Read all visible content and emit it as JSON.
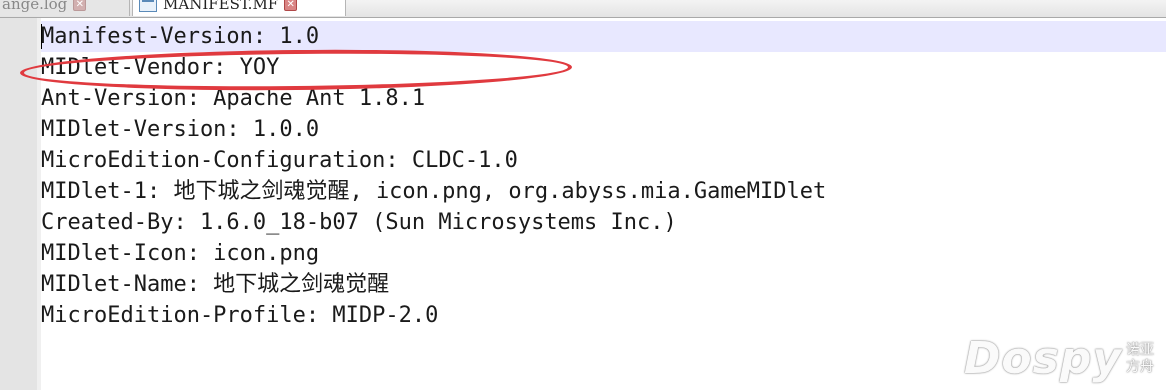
{
  "tabs": [
    {
      "label": "ange.log",
      "active": false
    },
    {
      "label": "MANIFEST.MF",
      "active": true
    }
  ],
  "editor": {
    "lines": [
      "Manifest-Version: 1.0",
      "MIDlet-Vendor: YOY",
      "Ant-Version: Apache Ant 1.8.1",
      "MIDlet-Version: 1.0.0",
      "MicroEdition-Configuration: CLDC-1.0",
      "MIDlet-1: 地下城之剑魂觉醒, icon.png, org.abyss.mia.GameMIDlet",
      "Created-By: 1.6.0_18-b07 (Sun Microsystems Inc.)",
      "MIDlet-Icon: icon.png",
      "MIDlet-Name: 地下城之剑魂觉醒",
      "MicroEdition-Profile: MIDP-2.0"
    ]
  },
  "annotation": {
    "color": "#e03a3f",
    "highlighted_line": "MIDlet-Vendor: YOY"
  },
  "watermark": {
    "main": "Dospy",
    "sub_1": "诺亚",
    "sub_2": "方舟"
  },
  "colors": {
    "current_line": "#e8e8ff",
    "gutter": "#e4e4e4"
  }
}
